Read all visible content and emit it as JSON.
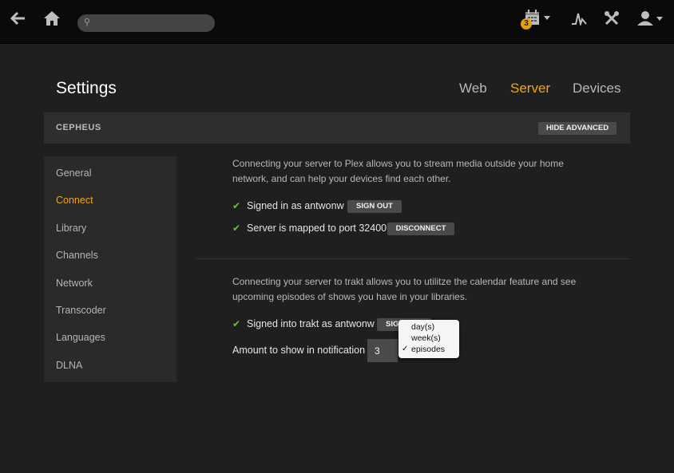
{
  "topbar": {
    "icons": [
      "back-arrow-icon",
      "home-icon",
      "calendar-icon",
      "activity-icon",
      "tools-icon",
      "user-icon"
    ],
    "search_placeholder": "",
    "calendar_badge": "3"
  },
  "header": {
    "title": "Settings",
    "tabs": [
      {
        "label": "Web",
        "active": false
      },
      {
        "label": "Server",
        "active": true
      },
      {
        "label": "Devices",
        "active": false
      }
    ]
  },
  "server_bar": {
    "name": "CEPHEUS",
    "hide_advanced_label": "HIDE ADVANCED"
  },
  "sidebar": {
    "items": [
      {
        "label": "General",
        "active": false
      },
      {
        "label": "Connect",
        "active": true
      },
      {
        "label": "Library",
        "active": false
      },
      {
        "label": "Channels",
        "active": false
      },
      {
        "label": "Network",
        "active": false
      },
      {
        "label": "Transcoder",
        "active": false
      },
      {
        "label": "Languages",
        "active": false
      },
      {
        "label": "DLNA",
        "active": false
      }
    ]
  },
  "plex_section": {
    "description": "Connecting your server to Plex allows you to stream media outside your home network, and can help your devices find each other.",
    "signed_in_text": "Signed in as antwonw",
    "sign_out_label": "SIGN OUT",
    "mapped_text": "Server is mapped to port 32400",
    "disconnect_label": "DISCONNECT"
  },
  "trakt_section": {
    "description": "Connecting your server to trakt allows you to utilitze the calendar feature and see upcoming episodes of shows you have in your libraries.",
    "signed_in_text": "Signed into trakt as antwonw",
    "sign_out_label": "SIG",
    "amount_label": "Amount to show in notification",
    "amount_value": "3",
    "unit_options": [
      "day(s)",
      "week(s)",
      "episodes"
    ],
    "selected_unit": "episodes"
  },
  "colors": {
    "accent": "#f6a50b",
    "check": "#6fbf3b",
    "background": "#1f1f1f"
  }
}
